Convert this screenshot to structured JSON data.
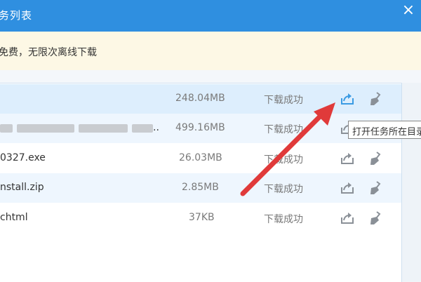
{
  "window": {
    "title": "务列表",
    "close_glyph": "×"
  },
  "notice": {
    "text": "免费，无限次离线下载"
  },
  "downloads": [
    {
      "name": "",
      "size": "248.04MB",
      "status": "下载成功"
    },
    {
      "name": "",
      "size": "499.16MB",
      "status": "下载成功"
    },
    {
      "name": "0327.exe",
      "size": "26.03MB",
      "status": "下载成功"
    },
    {
      "name": "nstall.zip",
      "size": "2.85MB",
      "status": "下载成功"
    },
    {
      "name": "chtml",
      "size": "37KB",
      "status": "下载成功"
    }
  ],
  "tooltip": {
    "text": "打开任务所在目录"
  },
  "icons": {
    "open_folder": "open-folder-icon",
    "delete": "broom-icon"
  },
  "colors": {
    "titlebar": "#2f8fe0",
    "selected_row": "#ddeefd",
    "alt_row": "#eef6fe",
    "notice_bg": "#fdf8e5",
    "annotation_arrow": "#e03a3a",
    "icon_blue": "#3b9be3",
    "icon_gray": "#8a9097"
  }
}
